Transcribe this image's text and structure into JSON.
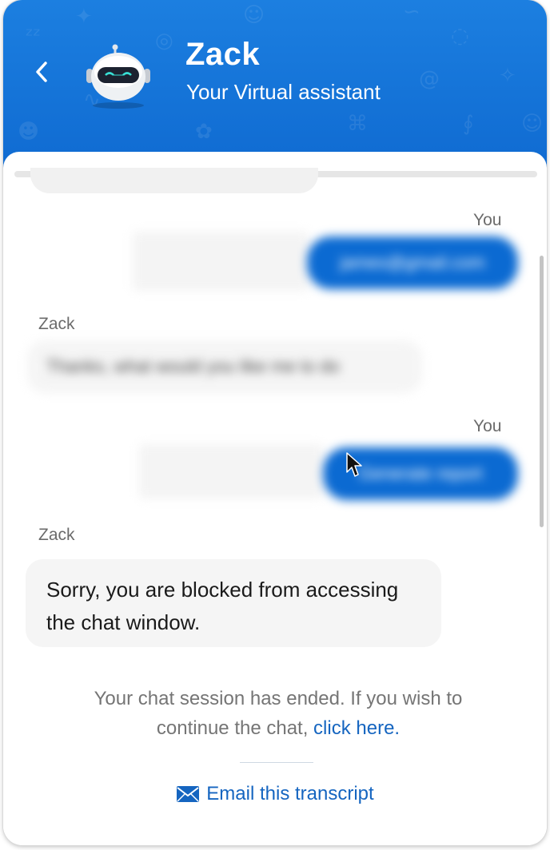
{
  "header": {
    "bot_name": "Zack",
    "subtitle": "Your Virtual assistant",
    "back_icon": "chevron-left-icon",
    "avatar_icon": "robot-avatar"
  },
  "messages": [
    {
      "sender": "You",
      "text": "james@gmail.com",
      "blurred": true
    },
    {
      "sender": "Zack",
      "text": "Thanks, what would you like me to do",
      "blurred": true
    },
    {
      "sender": "You",
      "text": "Generate report",
      "blurred": true
    },
    {
      "sender": "Zack",
      "text_line1": "Sorry, you are blocked from accessing",
      "text_line2": "the chat window.",
      "blurred": false
    }
  ],
  "session": {
    "ended_text_line1": "Your chat session has ended. If you wish to",
    "ended_text_line2": "continue the chat,",
    "link_text": "click here."
  },
  "email_transcript": {
    "label": "Email this transcript",
    "icon": "envelope-icon"
  },
  "colors": {
    "header_blue": "#1c7fe0",
    "user_bubble": "#0b6ad2",
    "link": "#1565c0"
  }
}
